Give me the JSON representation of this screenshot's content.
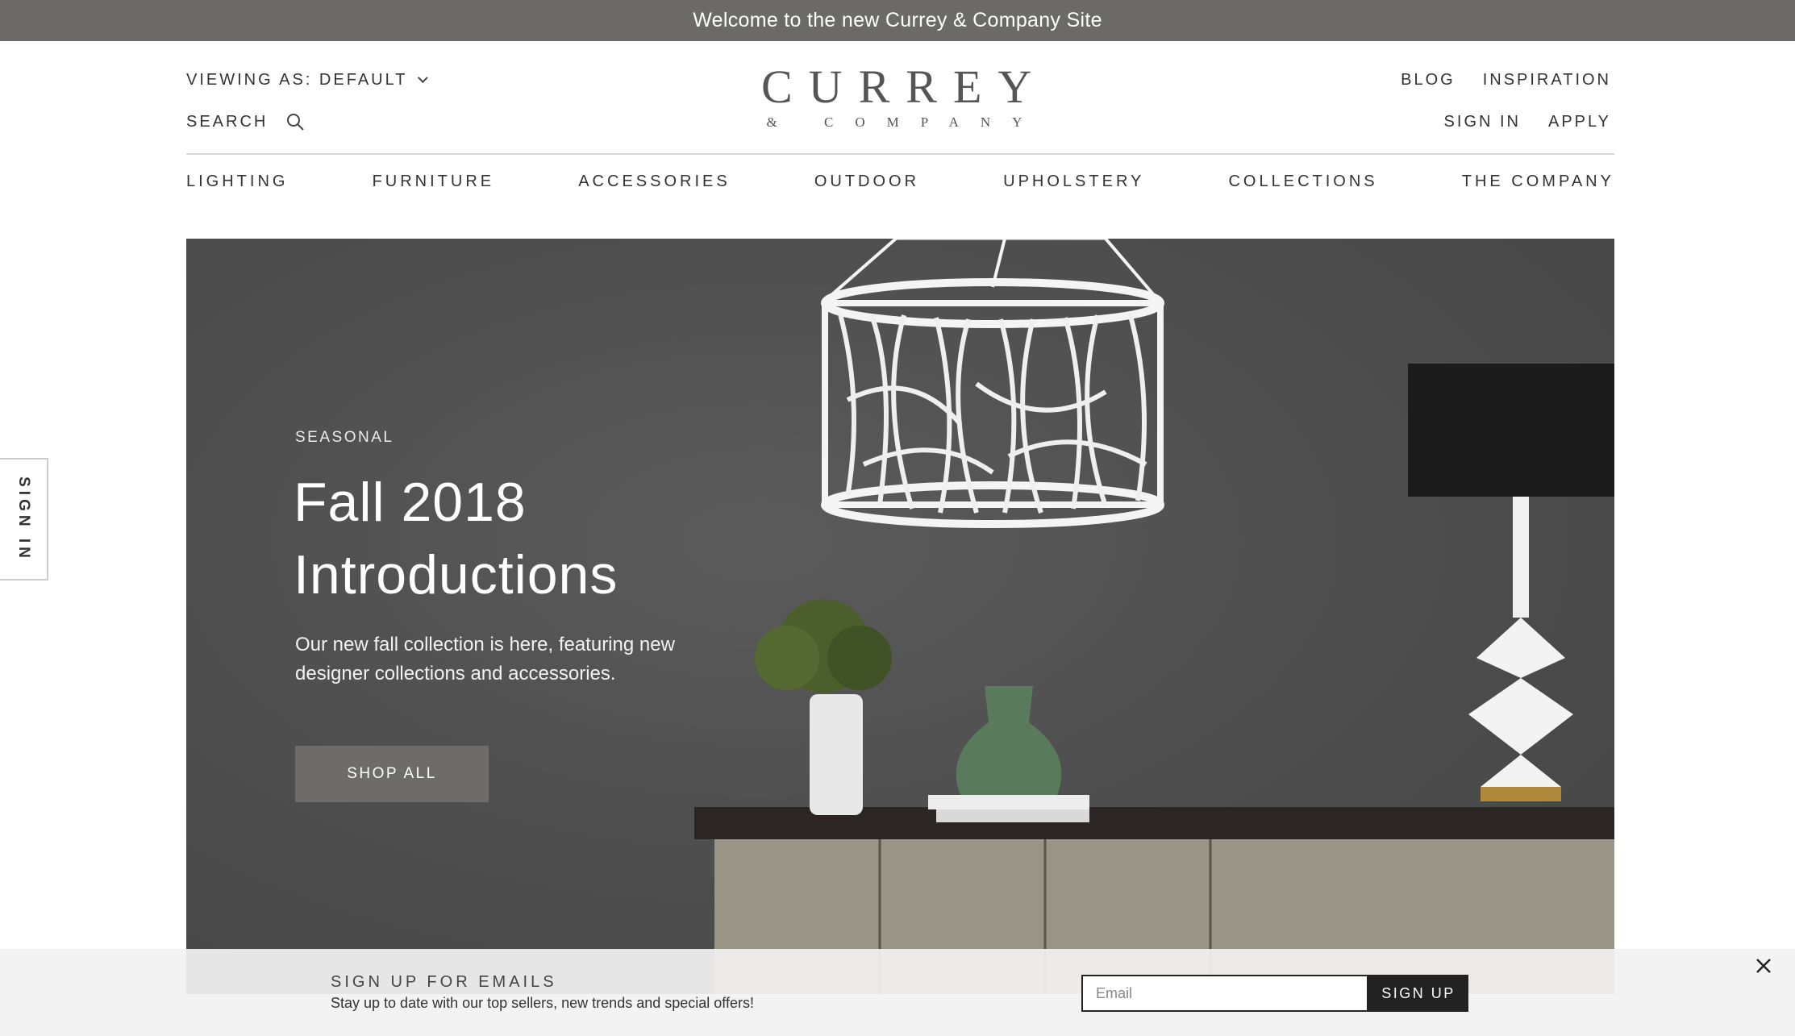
{
  "banner": {
    "text": "Welcome to the new Currey & Company Site"
  },
  "header": {
    "viewing_as": "VIEWING AS: DEFAULT",
    "search_label": "SEARCH",
    "logo_line1": "CURREY",
    "logo_line2": "& COMPANY",
    "blog": "BLOG",
    "inspiration": "INSPIRATION",
    "sign_in": "SIGN IN",
    "apply": "APPLY"
  },
  "nav": {
    "items": [
      "LIGHTING",
      "FURNITURE",
      "ACCESSORIES",
      "OUTDOOR",
      "UPHOLSTERY",
      "COLLECTIONS",
      "THE COMPANY"
    ]
  },
  "hero": {
    "kicker": "SEASONAL",
    "title_line1": "Fall 2018",
    "title_line2": "Introductions",
    "description": "Our new fall collection is here, featuring new designer collections and accessories.",
    "button": "SHOP ALL"
  },
  "side_tab": {
    "label": "SIGN IN"
  },
  "email_signup": {
    "title": "SIGN UP FOR EMAILS",
    "subtitle": "Stay up to date with our top sellers, new trends and special offers!",
    "placeholder": "Email",
    "button": "SIGN UP"
  },
  "icons": {
    "search": "search-icon",
    "dropdown": "chevron-down-icon",
    "close": "close-icon"
  },
  "colors": {
    "banner_bg": "#6b6a69",
    "hero_bg": "#4e4e4e",
    "button_bg": "#6d6c6b",
    "signup_btn": "#222222"
  }
}
